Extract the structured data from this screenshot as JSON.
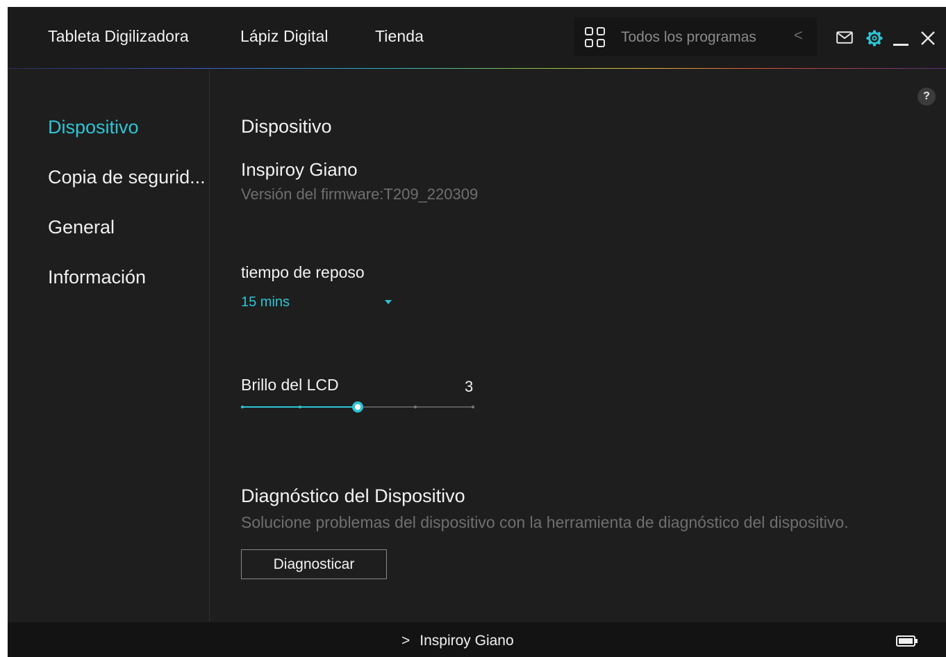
{
  "topbar": {
    "nav": [
      {
        "label": "Tableta Digilizadora"
      },
      {
        "label": "Lápiz Digital"
      },
      {
        "label": "Tienda"
      }
    ],
    "programs": {
      "label": "Todos los programas",
      "icon": "apps-grid-icon"
    },
    "icons": [
      "back-chevron-icon",
      "mail-icon",
      "settings-gear-icon",
      "minimize-icon",
      "close-icon"
    ],
    "accent_color": "#2fc4d4"
  },
  "sidebar": {
    "items": [
      {
        "label": "Dispositivo",
        "active": true
      },
      {
        "label": "Copia de segurid..."
      },
      {
        "label": "General"
      },
      {
        "label": "Información"
      }
    ]
  },
  "main": {
    "help_label": "?",
    "section_title": "Dispositivo",
    "device_name": "Inspiroy Giano",
    "firmware": "Versión del firmware:T209_220309",
    "sleep": {
      "label": "tiempo de reposo",
      "value": "15 mins"
    },
    "lcd": {
      "label": "Brillo del LCD",
      "value": "3",
      "level": 3,
      "min": 1,
      "max": 5
    },
    "diagnostics": {
      "title": "Diagnóstico del Dispositivo",
      "description": "Solucione problemas del dispositivo con la herramienta de diagnóstico del dispositivo.",
      "button_label": "Diagnosticar"
    }
  },
  "footer": {
    "device_label": "Inspiroy Giano",
    "battery_icon": "battery-icon"
  }
}
